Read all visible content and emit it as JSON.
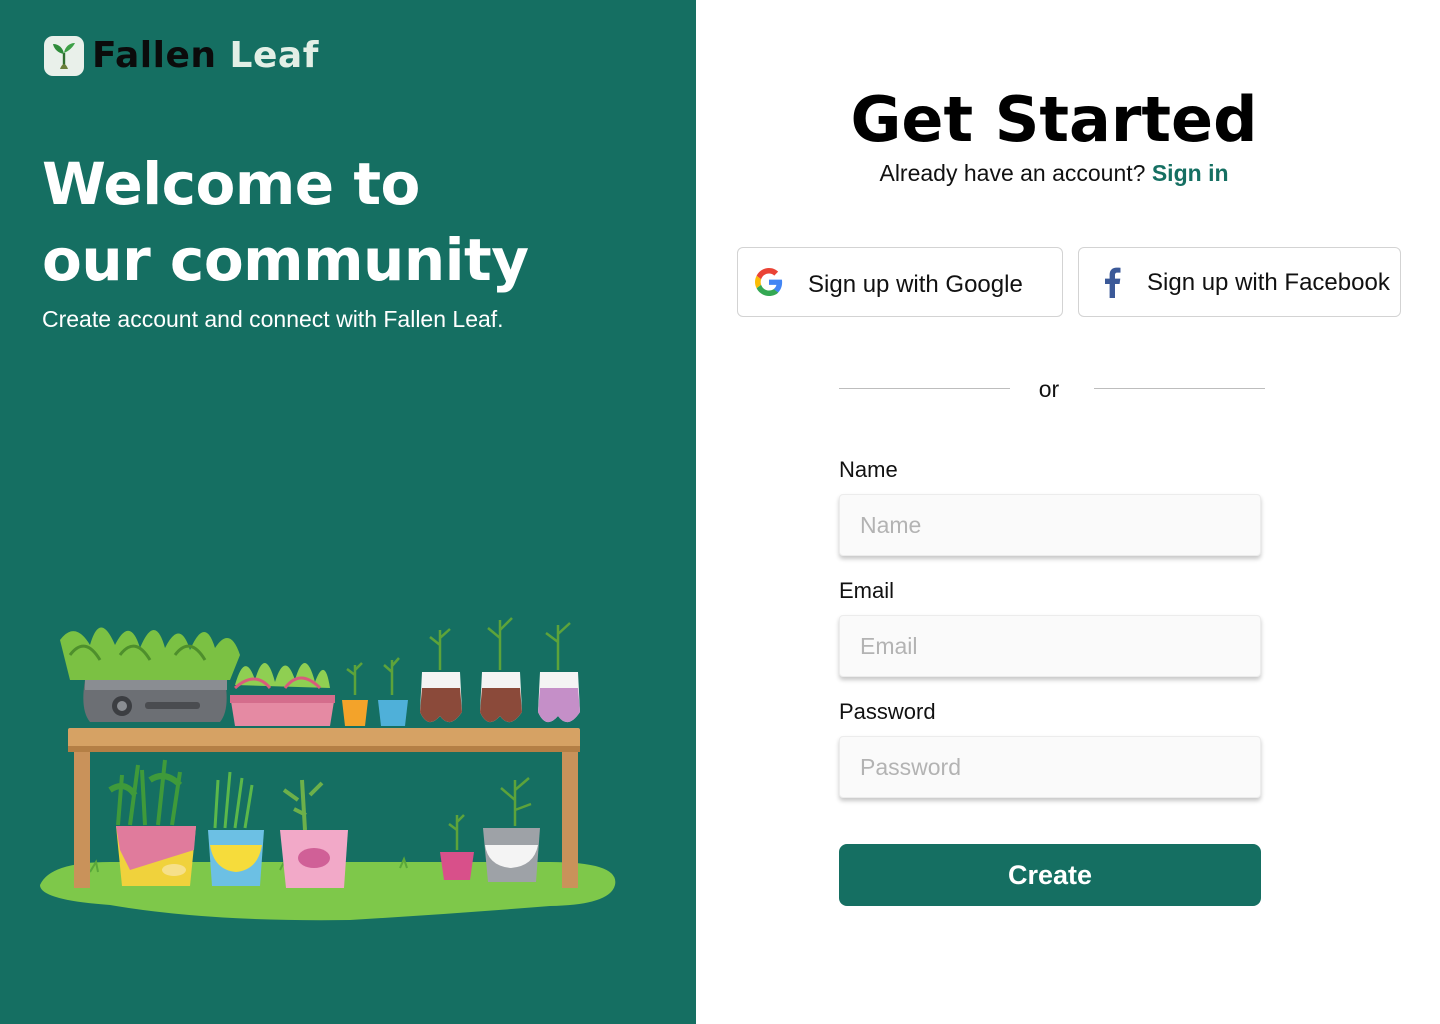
{
  "brand": {
    "name_part1": "Fallen",
    "name_part2": "Leaf",
    "logo_icon": "sprout-icon"
  },
  "hero": {
    "title_line1": "Welcome to",
    "title_line2": "our community",
    "subtitle": "Create account and connect with Fallen Leaf."
  },
  "form": {
    "title": "Get Started",
    "signin_prompt": "Already have an account?",
    "signin_link": "Sign in",
    "google_label": "Sign up with Google",
    "facebook_label": "Sign up with Facebook",
    "divider": "or",
    "fields": [
      {
        "label": "Name",
        "placeholder": "Name",
        "value": ""
      },
      {
        "label": "Email",
        "placeholder": "Email",
        "value": ""
      },
      {
        "label": "Password",
        "placeholder": "Password",
        "value": ""
      }
    ],
    "submit_label": "Create"
  },
  "colors": {
    "primary": "#156f62",
    "white": "#ffffff",
    "link": "#156f62"
  }
}
